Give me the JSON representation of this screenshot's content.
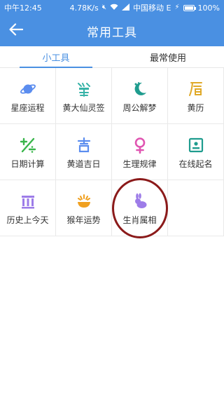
{
  "status_bar": {
    "time": "中午12:45",
    "speed": "4.78K/s",
    "carrier": "中国移动 E",
    "battery_text": "100%",
    "battery_level": 1.0
  },
  "app_bar": {
    "title": "常用工具",
    "back_icon": "arrow-left-icon"
  },
  "tabs": [
    {
      "label": "小工具",
      "active": true
    },
    {
      "label": "最常使用",
      "active": false
    }
  ],
  "colors": {
    "primary": "#4a90e2",
    "divider": "#e9e9e9",
    "highlight_ring": "#8b1a1a"
  },
  "tools": [
    {
      "label": "星座运程",
      "icon": "planet-icon",
      "color": "#5b8def"
    },
    {
      "label": "黄大仙灵签",
      "icon": "lot-sign-icon",
      "color": "#37b3a7"
    },
    {
      "label": "周公解梦",
      "icon": "moon-stars-icon",
      "color": "#1f9c8e"
    },
    {
      "label": "黄历",
      "icon": "almanac-icon",
      "color": "#e0a928"
    },
    {
      "label": "日期计算",
      "icon": "date-calc-icon",
      "color": "#39b54a"
    },
    {
      "label": "黄道吉日",
      "icon": "lucky-day-icon",
      "color": "#5b8def"
    },
    {
      "label": "生理规律",
      "icon": "female-symbol-icon",
      "color": "#e055b1"
    },
    {
      "label": "在线起名",
      "icon": "name-card-icon",
      "color": "#1f9c8e"
    },
    {
      "label": "历史上今天",
      "icon": "history-columns-icon",
      "color": "#9d7ce8"
    },
    {
      "label": "猴年运势",
      "icon": "fortune-bowl-icon",
      "color": "#f0a020"
    },
    {
      "label": "生肖属相",
      "icon": "rabbit-icon",
      "color": "#9d7ce8"
    }
  ]
}
